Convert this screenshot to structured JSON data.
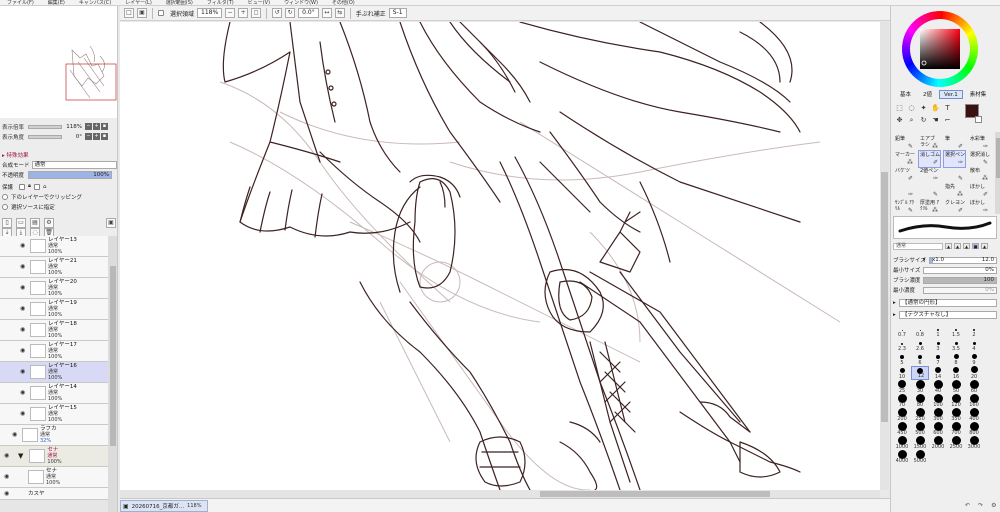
{
  "menu": {
    "items": [
      "ファイル(F)",
      "編集(E)",
      "キャンバス(C)",
      "レイヤー(L)",
      "選択範囲(S)",
      "フィルタ(T)",
      "ビュー(V)",
      "ウィンドウ(W)",
      "その他(O)"
    ]
  },
  "toolbar": {
    "selection_checkbox_label": "選択領域",
    "zoom_value": "118%",
    "rotation_value": "0.0°",
    "stabilizer_label": "手ぶれ補正",
    "stabilizer_value": "S-1"
  },
  "navigator": {
    "zoom_label": "表示倍率",
    "zoom_value": "118%",
    "angle_label": "表示角度",
    "angle_value": "0°"
  },
  "layer_props": {
    "effects_header": "▸ 特殊効果",
    "blend_label": "合成モード",
    "blend_value": "通常",
    "opacity_label": "不透明度",
    "opacity_value": "100%",
    "protect_label": "保護",
    "clip_label": "下のレイヤーでクリッピング",
    "source_label": "選択ソースに指定"
  },
  "layers": [
    {
      "name": "レイヤー13",
      "mode": "通常",
      "opacity": "100%"
    },
    {
      "name": "レイヤー21",
      "mode": "通常",
      "opacity": "100%"
    },
    {
      "name": "レイヤー20",
      "mode": "通常",
      "opacity": "100%"
    },
    {
      "name": "レイヤー19",
      "mode": "通常",
      "opacity": "100%"
    },
    {
      "name": "レイヤー18",
      "mode": "通常",
      "opacity": "100%"
    },
    {
      "name": "レイヤー17",
      "mode": "通常",
      "opacity": "100%"
    },
    {
      "name": "レイヤー16",
      "mode": "通常",
      "opacity": "100%"
    },
    {
      "name": "レイヤー14",
      "mode": "通常",
      "opacity": "100%"
    },
    {
      "name": "レイヤー15",
      "mode": "通常",
      "opacity": "100%"
    },
    {
      "name": "ラフカ",
      "mode": "通常",
      "opacity": "32%"
    },
    {
      "name": "セナ",
      "mode": "通常",
      "opacity": "100%"
    },
    {
      "name": "セナ",
      "mode": "通常",
      "opacity": "100%"
    },
    {
      "name": "カスヤ",
      "mode": "",
      "opacity": ""
    }
  ],
  "document_tab": {
    "name": "20260716_京都ガ...",
    "zoom": "118%"
  },
  "color_tabs": [
    "基本",
    "2値",
    "Ver.1",
    "素材集"
  ],
  "colors": {
    "main": "#3b1112",
    "sub": "#ffffff",
    "accent": "#6f8fcf"
  },
  "brushes": [
    [
      "鉛筆",
      "エアブラシ",
      "筆",
      "水彩筆"
    ],
    [
      "マーカー",
      "消しゴム",
      "選択ペン",
      "選択消し"
    ],
    [
      "バケツ",
      "2値ペン",
      "",
      "散布"
    ],
    [
      "",
      "",
      "指先",
      "ぼかし"
    ],
    [
      "ｻﾝﾌﾟﾙ ｱｸﾘﾙ",
      "厚塗用 ｱｸﾘﾙ",
      "クレヨン",
      "ぼかし"
    ]
  ],
  "brush_props": {
    "shape_value": "通常",
    "size_label": "ブラシサイズ",
    "size_multiplier": "x1.0",
    "size_value": "12.0",
    "min_size_label": "最小サイズ",
    "min_size_value": "0%",
    "density_label": "ブラシ濃度",
    "density_value": "100",
    "min_density_label": "最小濃度",
    "min_density_value": "0%",
    "edge_label": "【通常の円形】",
    "texture_label": "【テクスチャなし】"
  },
  "size_presets": [
    "0.7",
    "0.8",
    "1",
    "1.5",
    "2",
    "2.3",
    "2.6",
    "3",
    "3.5",
    "4",
    "5",
    "6",
    "7",
    "8",
    "9",
    "10",
    "12",
    "14",
    "16",
    "20",
    "25",
    "30",
    "40",
    "50",
    "60",
    "70",
    "80",
    "100",
    "120",
    "160",
    "200",
    "250",
    "300",
    "350",
    "400",
    "450",
    "500",
    "600",
    "700",
    "800",
    "1000",
    "1500",
    "2000",
    "2500",
    "3000",
    "4000",
    "5000"
  ],
  "selected_size": "12"
}
